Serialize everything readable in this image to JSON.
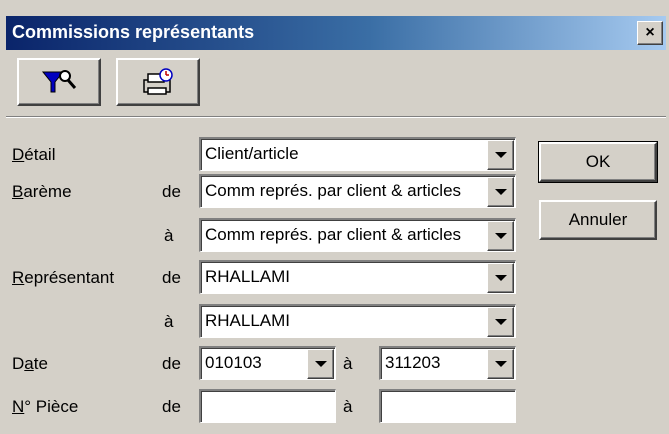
{
  "window": {
    "title": "Commissions représentants",
    "close_label": "×"
  },
  "toolbar": {
    "filter_icon": "filter-search-icon",
    "print_icon": "printer-clock-icon"
  },
  "labels": {
    "detail_a": "D",
    "detail_b": "étail",
    "bareme_a": "B",
    "bareme_b": "arème",
    "representant_a": "R",
    "representant_b": "eprésentant",
    "date_a": "D",
    "date_u": "a",
    "date_b": "te",
    "piece_a": "N",
    "piece_b": "° Pièce",
    "de": "de",
    "a": "à"
  },
  "fields": {
    "detail": "Client/article",
    "bareme_from": "Comm représ. par client & articles",
    "bareme_to": "Comm représ. par client & articles",
    "rep_from": "RHALLAMI",
    "rep_to": "RHALLAMI",
    "date_from": "010103",
    "date_to": "311203",
    "piece_from": "",
    "piece_to": ""
  },
  "buttons": {
    "ok": "OK",
    "cancel": "Annuler"
  }
}
